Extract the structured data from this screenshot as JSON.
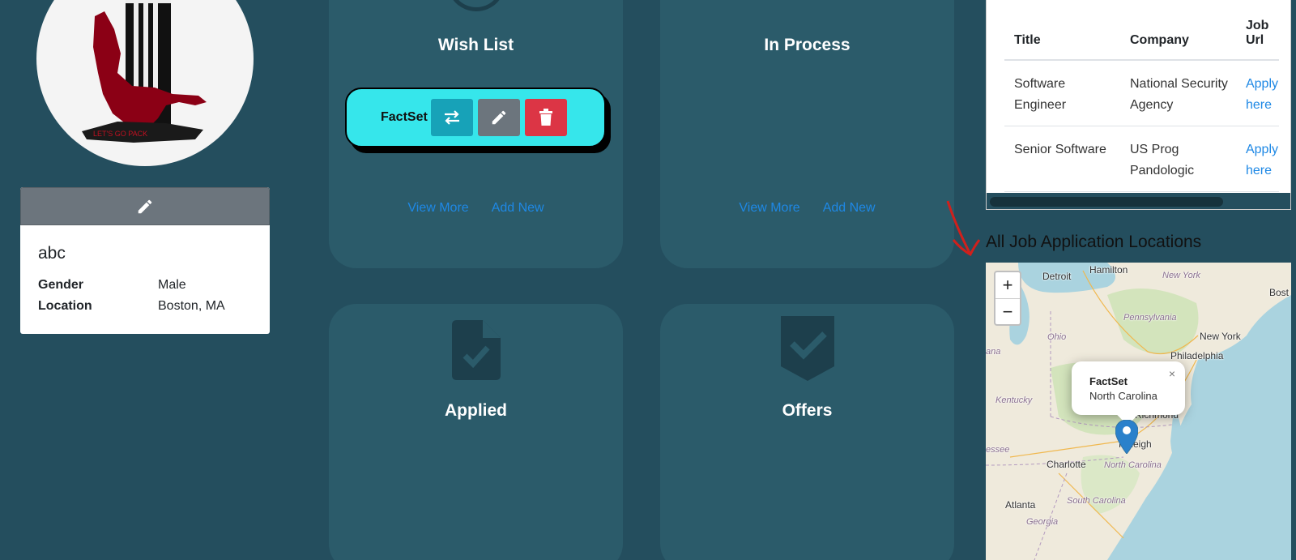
{
  "profile": {
    "avatar_caption": "LET'S GO PACK",
    "name": "abc",
    "fields": [
      {
        "label": "Gender",
        "value": "Male"
      },
      {
        "label": "Location",
        "value": "Boston, MA"
      }
    ]
  },
  "boards": {
    "wish": {
      "title": "Wish List",
      "view_more": "View More",
      "add_new": "Add New",
      "cards": [
        {
          "company": "FactSet"
        }
      ]
    },
    "in_process": {
      "title": "In Process",
      "view_more": "View More",
      "add_new": "Add New"
    },
    "applied": {
      "title": "Applied"
    },
    "offers": {
      "title": "Offers"
    }
  },
  "jobs_table": {
    "headers": [
      "Title",
      "Company",
      "Job Url"
    ],
    "rows": [
      {
        "title": "Software Engineer",
        "company": "National Security Agency",
        "url": "Apply here"
      },
      {
        "title": "Senior Software",
        "company": "US Prog Pandologic",
        "url": "Apply here"
      }
    ]
  },
  "map": {
    "heading": "All Job Application Locations",
    "zoom_in": "+",
    "zoom_out": "−",
    "popup": {
      "title": "FactSet",
      "subtitle": "North Carolina",
      "close": "×"
    },
    "labels": {
      "detroit": "Detroit",
      "hamilton": "Hamilton",
      "new_york_state": "New York",
      "boston": "Bost",
      "pennsylvania": "Pennsylvania",
      "ohio": "Ohio",
      "new_york_city": "New York",
      "philadelphia": "Philadelphia",
      "indiana": "ana",
      "kentucky": "Kentucky",
      "richmond": "Richmond",
      "raleigh": "Raleigh",
      "tennessee": "essee",
      "charlotte": "Charlotte",
      "north_carolina": "North Carolina",
      "south_carolina": "South Carolina",
      "atlanta": "Atlanta",
      "georgia": "Georgia"
    }
  },
  "colors": {
    "page_bg": "#244e5e",
    "board_bg": "#2b5b6a",
    "card_bg": "#36e6eb",
    "link": "#1e88e5",
    "danger": "#dc3545",
    "info": "#17a2b8",
    "secondary": "#6c757d"
  }
}
